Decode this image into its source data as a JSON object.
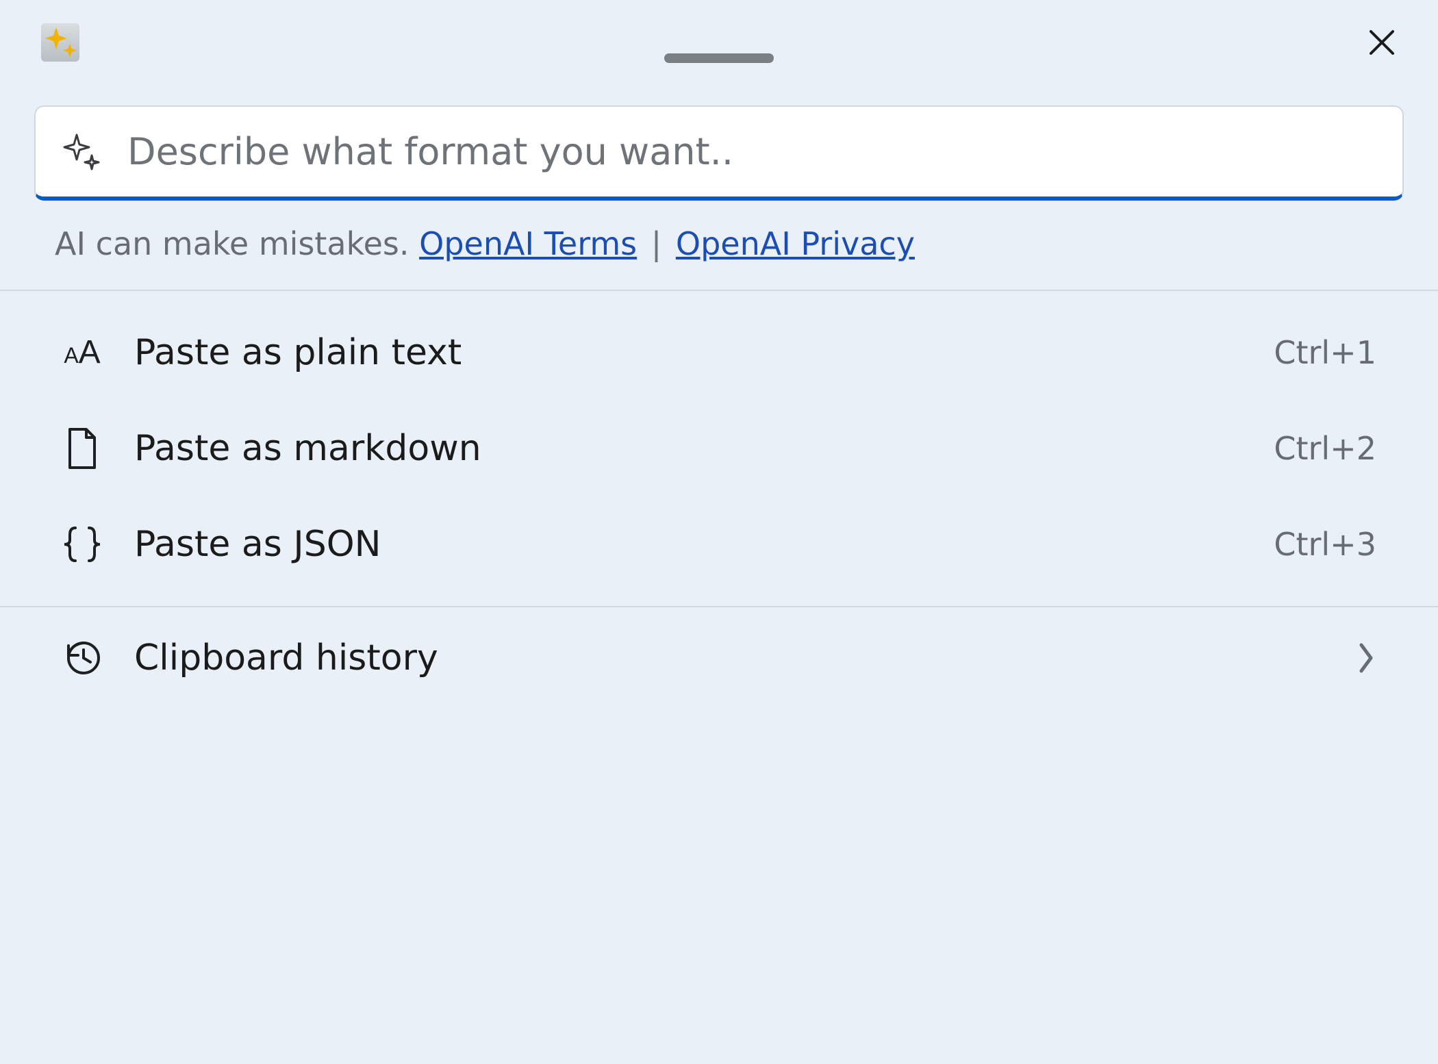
{
  "prompt": {
    "placeholder": "Describe what format you want.."
  },
  "disclaimer": {
    "prefix": "AI can make mistakes. ",
    "terms_label": "OpenAI Terms",
    "separator": " | ",
    "privacy_label": "OpenAI Privacy"
  },
  "options": [
    {
      "label": "Paste as plain text",
      "shortcut": "Ctrl+1"
    },
    {
      "label": "Paste as markdown",
      "shortcut": "Ctrl+2"
    },
    {
      "label": "Paste as JSON",
      "shortcut": "Ctrl+3"
    }
  ],
  "footer": {
    "clipboard_history": "Clipboard history"
  }
}
